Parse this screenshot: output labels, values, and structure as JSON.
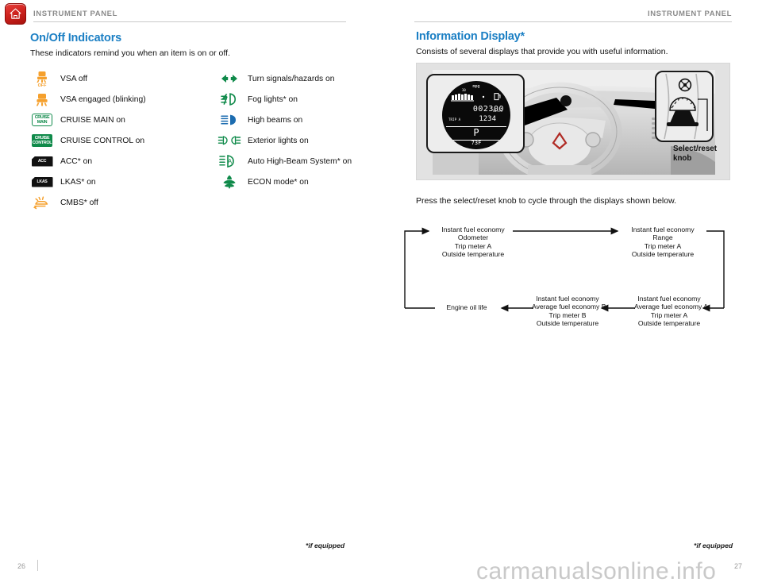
{
  "header": {
    "home_icon": "home-icon",
    "left_title": "INSTRUMENT PANEL",
    "right_title": "INSTRUMENT PANEL"
  },
  "left_page": {
    "heading": "On/Off Indicators",
    "subtitle": "These indicators remind you when an item is on or off.",
    "indicators_col1": [
      {
        "icon": "vsa-off-icon",
        "label": "VSA off"
      },
      {
        "icon": "vsa-engaged-icon",
        "label": "VSA engaged (blinking)"
      },
      {
        "icon": "cruise-main-badge",
        "label": "CRUISE MAIN on",
        "badge_line1": "CRUISE",
        "badge_line2": "MAIN"
      },
      {
        "icon": "cruise-control-badge",
        "label": "CRUISE CONTROL on",
        "badge_line1": "CRUISE",
        "badge_line2": "CONTROL"
      },
      {
        "icon": "acc-badge",
        "label": "ACC* on",
        "badge_line1": "ACC"
      },
      {
        "icon": "lkas-badge",
        "label": "LKAS* on",
        "badge_line1": "LKAS"
      },
      {
        "icon": "cmbs-off-icon",
        "label": "CMBS* off"
      }
    ],
    "indicators_col2": [
      {
        "icon": "turn-signal-arrows-icon",
        "label": "Turn signals/hazards on"
      },
      {
        "icon": "fog-light-icon",
        "label": "Fog lights* on"
      },
      {
        "icon": "high-beam-icon",
        "label": "High beams on"
      },
      {
        "icon": "exterior-lights-icon",
        "label": "Exterior lights on"
      },
      {
        "icon": "auto-high-beam-icon",
        "label": "Auto High-Beam System* on"
      },
      {
        "icon": "econ-leaf-icon",
        "label": "ECON mode* on"
      }
    ]
  },
  "right_page": {
    "heading": "Information Display*",
    "subtitle": "Consists of several displays that provide you with useful information.",
    "instruction": "Press the select/reset knob to cycle through the displays shown below.",
    "callout_label": "Select/reset\nknob",
    "callout_label_line1": "Select/reset",
    "callout_label_line2": "knob",
    "lcd": {
      "mpg_label": "mpg",
      "gauge_min": "0",
      "gauge_max": "30",
      "odometer": "002300",
      "odometer_unit": "miles",
      "trip_label": "TRIP A",
      "trip_value": "1234",
      "gear": "P",
      "temperature": "73F"
    }
  },
  "flow_diagram": {
    "nodes": [
      {
        "id": "n1",
        "lines": [
          "Instant fuel economy",
          "Odometer",
          "Trip meter A",
          "Outside temperature"
        ]
      },
      {
        "id": "n2",
        "lines": [
          "Instant fuel economy",
          "Range",
          "Trip meter A",
          "Outside temperature"
        ]
      },
      {
        "id": "n3",
        "lines": [
          "Instant fuel economy",
          "Average fuel economy A",
          "Trip meter A",
          "Outside temperature"
        ]
      },
      {
        "id": "n4",
        "lines": [
          "Instant fuel economy",
          "Average fuel economy B",
          "Trip meter B",
          "Outside temperature"
        ]
      },
      {
        "id": "n5",
        "lines": [
          "Engine oil life"
        ]
      }
    ]
  },
  "footer": {
    "note_left": "*if equipped",
    "note_right": "*if equipped",
    "page_left": "26",
    "page_right": "27",
    "watermark": "carmanualsonline.info"
  },
  "colors": {
    "accent_blue": "#1b7fc4",
    "green": "#0f8a4a",
    "orange": "#f5a02d",
    "blue_beam": "#1c6cb0",
    "header_gray": "#8b8b8b",
    "home_red": "#d0241f"
  }
}
